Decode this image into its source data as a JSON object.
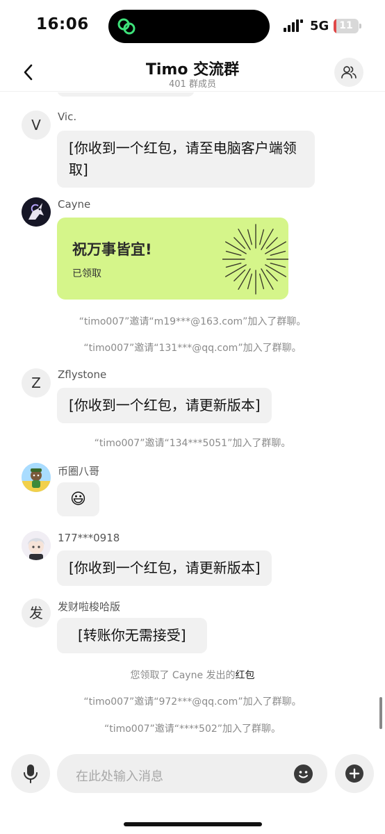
{
  "status_bar": {
    "time": "16:06",
    "network": "5G",
    "battery": "11",
    "battery_level": 0.11,
    "battery_color": "#e04848"
  },
  "header": {
    "title": "Timo 交流群",
    "subtitle": "401 群成员",
    "back_icon": "chevron-left-icon",
    "members_icon": "group-members-icon"
  },
  "messages": {
    "vic": {
      "avatar_letter": "V",
      "sender": "Vic.",
      "line1": "[你收到一个红包，请至电脑客户端领",
      "line2": "取]"
    },
    "cayne": {
      "sender": "Cayne",
      "packet_title": "祝万事皆宜!",
      "packet_status": "已领取",
      "packet_color": "#d5f58a"
    },
    "sys1": "“timo007”邀请“m19***@163.com”加入了群聊。",
    "sys2": "“timo007”邀请“131***@qq.com”加入了群聊。",
    "zflystone": {
      "avatar_letter": "Z",
      "sender": "Zflystone",
      "text": "[你收到一个红包，请更新版本]"
    },
    "sys3": "“timo007”邀请“134***5051”加入了群聊。",
    "bibaguo": {
      "sender": "币圈八哥",
      "emoji": "😃"
    },
    "user177": {
      "sender": "177***0918",
      "text": "[你收到一个红包，请更新版本]"
    },
    "facai": {
      "avatar_letter": "发",
      "sender": "发财啦梭哈版",
      "text": "[转账你无需接受]"
    },
    "sys4_prefix": "您领取了 Cayne 发出的",
    "sys4_link": "红包",
    "sys5": "“timo007”邀请“972***@qq.com”加入了群聊。",
    "sys6": "“timo007”邀请“****502”加入了群聊。"
  },
  "input_bar": {
    "placeholder": "在此处输入消息",
    "mic_icon": "microphone-icon",
    "emoji_icon": "smiley-icon",
    "plus_icon": "plus-icon"
  }
}
